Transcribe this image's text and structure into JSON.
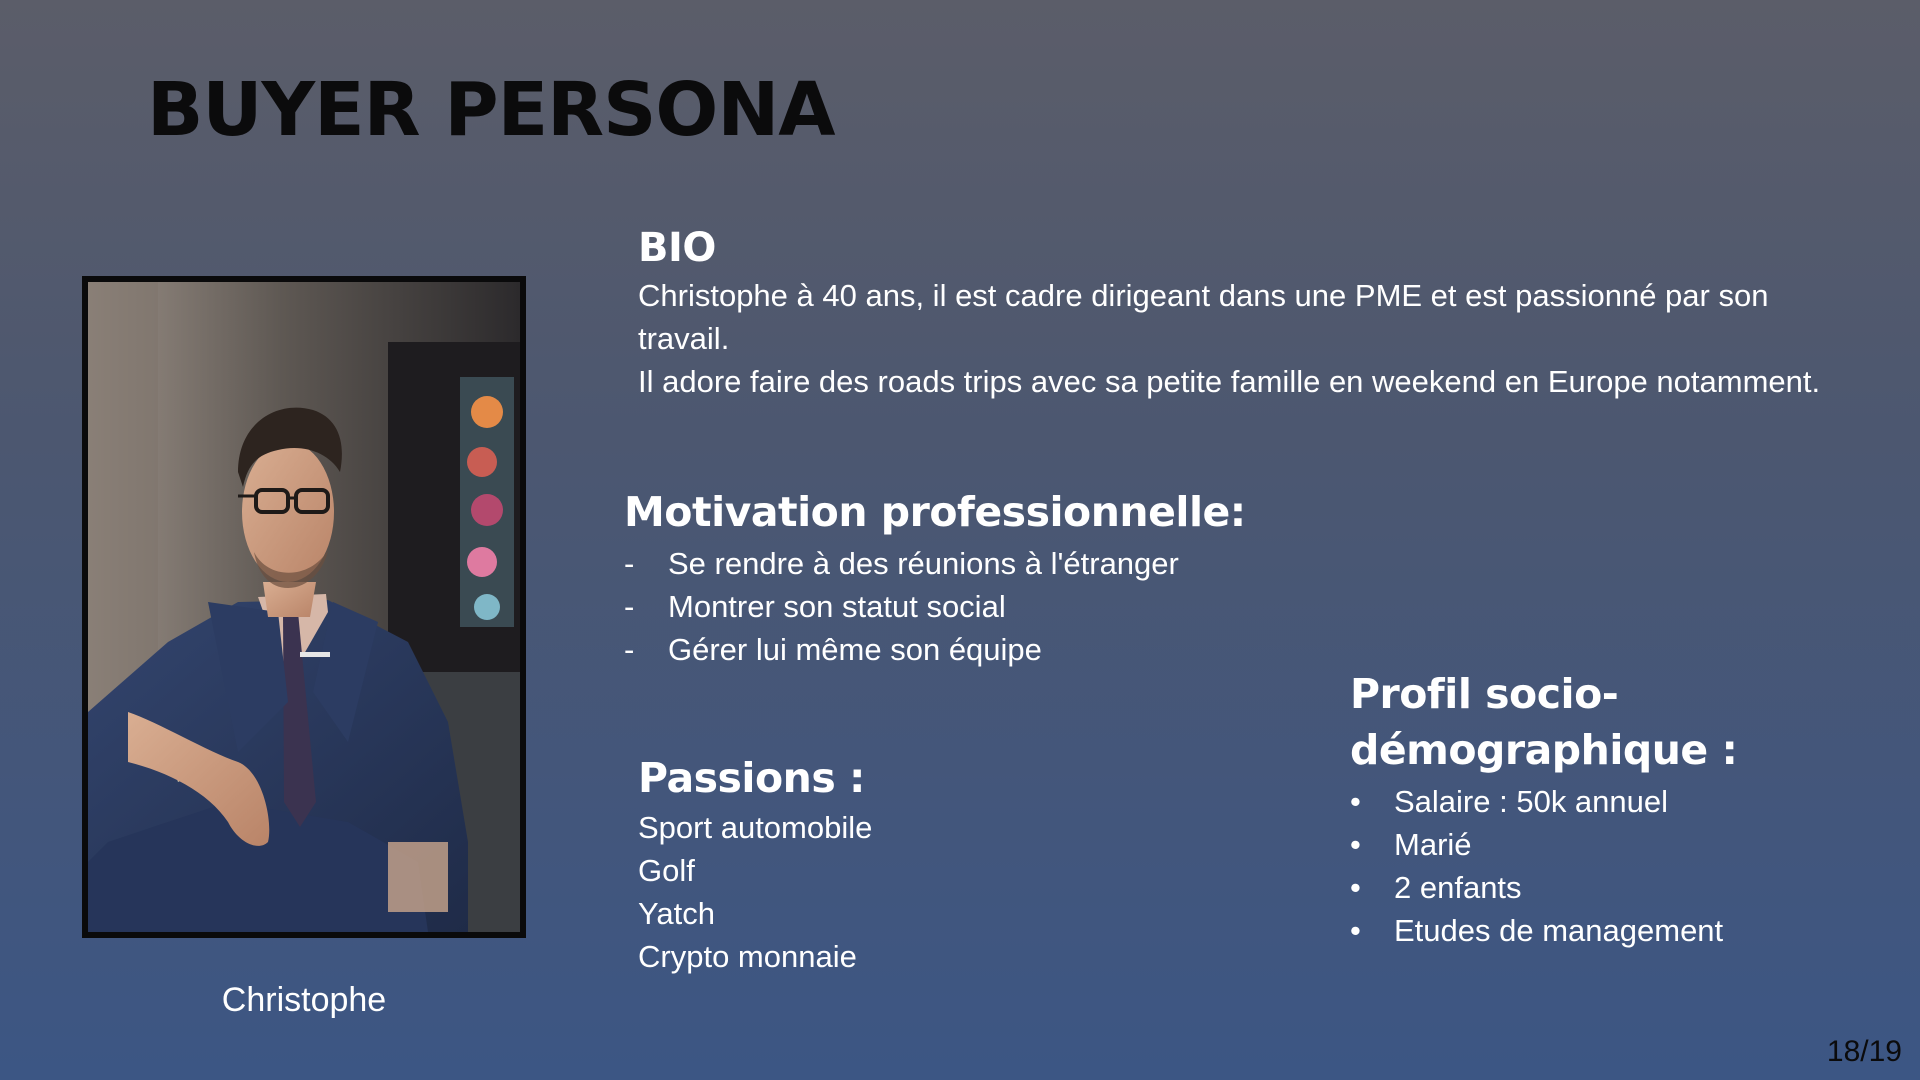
{
  "slide": {
    "title": "BUYER PERSONA",
    "page_number": "18/19"
  },
  "persona": {
    "name": "Christophe",
    "photo": "businessman-portrait-photo"
  },
  "bio": {
    "heading": "BIO",
    "paragraphs": [
      "Christophe à 40 ans, il est cadre dirigeant dans une PME et est passionné par son travail.",
      "Il adore faire des roads trips avec sa petite famille en weekend en Europe notamment."
    ]
  },
  "motivation": {
    "heading": "Motivation professionnelle:",
    "items": [
      "Se rendre à des réunions à l'étranger",
      "Montrer son statut social",
      "Gérer lui même son équipe"
    ]
  },
  "passions": {
    "heading": "Passions :",
    "items": [
      "Sport automobile",
      "Golf",
      "Yatch",
      "Crypto monnaie"
    ]
  },
  "profil": {
    "heading": "Profil socio-démographique :",
    "items": [
      "Salaire : 50k annuel",
      "Marié",
      "2 enfants",
      "Etudes de management"
    ]
  },
  "colors": {
    "background_top": "#5b5d69",
    "background_bottom": "#3c5684",
    "title_text": "#0b0b0c",
    "body_text": "#ffffff"
  }
}
